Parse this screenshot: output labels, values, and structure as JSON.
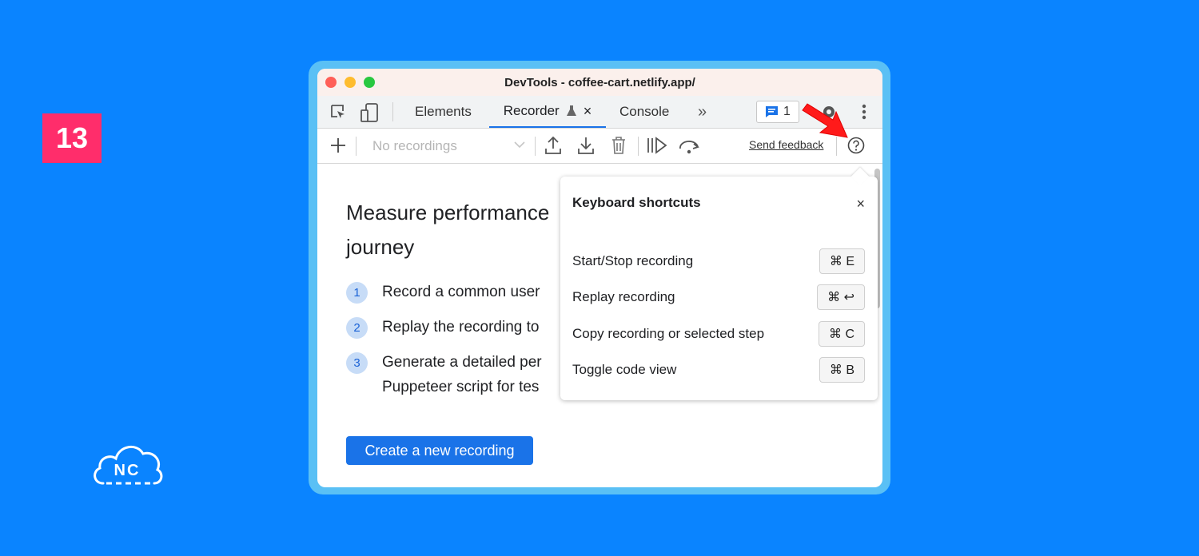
{
  "slide_number": "13",
  "logo_text": "NC",
  "window": {
    "title": "DevTools - coffee-cart.netlify.app/",
    "traffic_lights": [
      "#ff5f57",
      "#febc2e",
      "#28c840"
    ]
  },
  "tabs": {
    "elements": "Elements",
    "recorder": "Recorder",
    "console": "Console",
    "more": "»",
    "issues_count": "1"
  },
  "toolbar": {
    "recordings_placeholder": "No recordings",
    "send_feedback": "Send feedback"
  },
  "main": {
    "heading_line1": "Measure performance",
    "heading_line2": "journey",
    "steps": [
      {
        "num": "1",
        "text": "Record a common user"
      },
      {
        "num": "2",
        "text": "Replay the recording to"
      },
      {
        "num": "3",
        "text": "Generate a detailed per",
        "text2": "Puppeteer script for tes"
      }
    ],
    "create_button": "Create a new recording"
  },
  "shortcuts": {
    "title": "Keyboard shortcuts",
    "close": "×",
    "items": [
      {
        "label": "Start/Stop recording",
        "keys": "⌘ E"
      },
      {
        "label": "Replay recording",
        "keys": "⌘ ↩"
      },
      {
        "label": "Copy recording or selected step",
        "keys": "⌘ C"
      },
      {
        "label": "Toggle code view",
        "keys": "⌘ B"
      }
    ]
  },
  "colors": {
    "background": "#0a84ff",
    "badge": "#ff2d6b",
    "accent": "#1a73e8",
    "annotation_arrow": "#ff1a1a"
  }
}
